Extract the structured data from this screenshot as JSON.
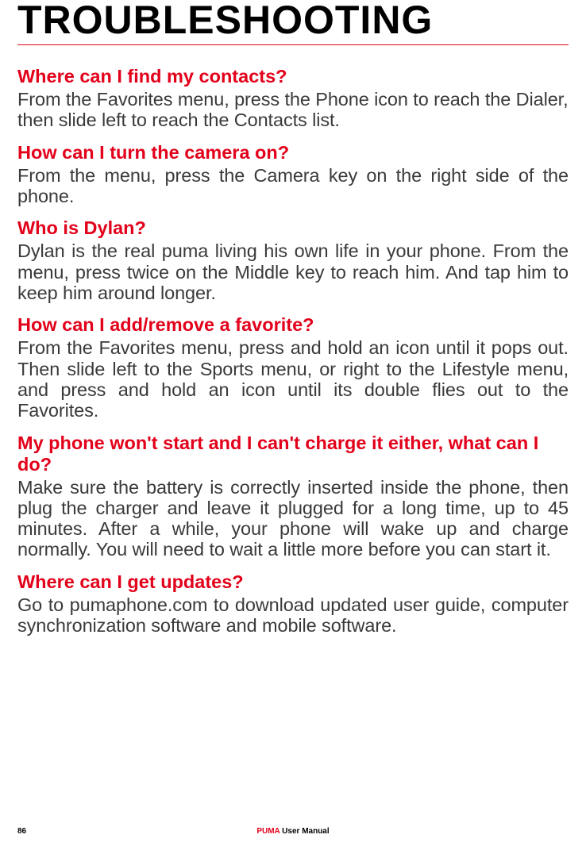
{
  "title": "TROUBLESHOOTING",
  "faq": [
    {
      "q": "Where can I find my contacts?",
      "a": "From the Favorites menu, press the Phone icon to reach the Dialer, then slide left to reach the Contacts list.",
      "justify": false
    },
    {
      "q": "How can I turn the camera on?",
      "a": "From the menu, press the Camera key on the right side of the phone.",
      "justify": true
    },
    {
      "q": "Who is Dylan?",
      "a": "Dylan is the real puma living his own life in your phone. From the menu, press twice on the Middle key to reach him. And tap him to keep him around longer.",
      "justify": true
    },
    {
      "q": "How can I add/remove a favorite?",
      "a": "From the Favorites menu, press and hold an icon until it pops out. Then slide left to the Sports menu, or right to the Lifestyle menu, and press and hold an icon until its double flies out to the Favorites.",
      "justify": true
    },
    {
      "q": "My phone won't start and I can't charge it either, what can I do?",
      "a": "Make sure the battery is correctly inserted inside the phone, then plug the charger and leave it plugged for a long time, up to 45 minutes. After a while, your phone will wake up and charge normally. You will need to wait a little more before you can start it.",
      "justify": true
    },
    {
      "q": "Where can I get updates?",
      "a": "Go to pumaphone.com to download updated user guide, computer synchronization software and mobile software.",
      "justify": true
    }
  ],
  "footer": {
    "page_number": "86",
    "brand": "PUMA",
    "suffix": " User Manual"
  }
}
